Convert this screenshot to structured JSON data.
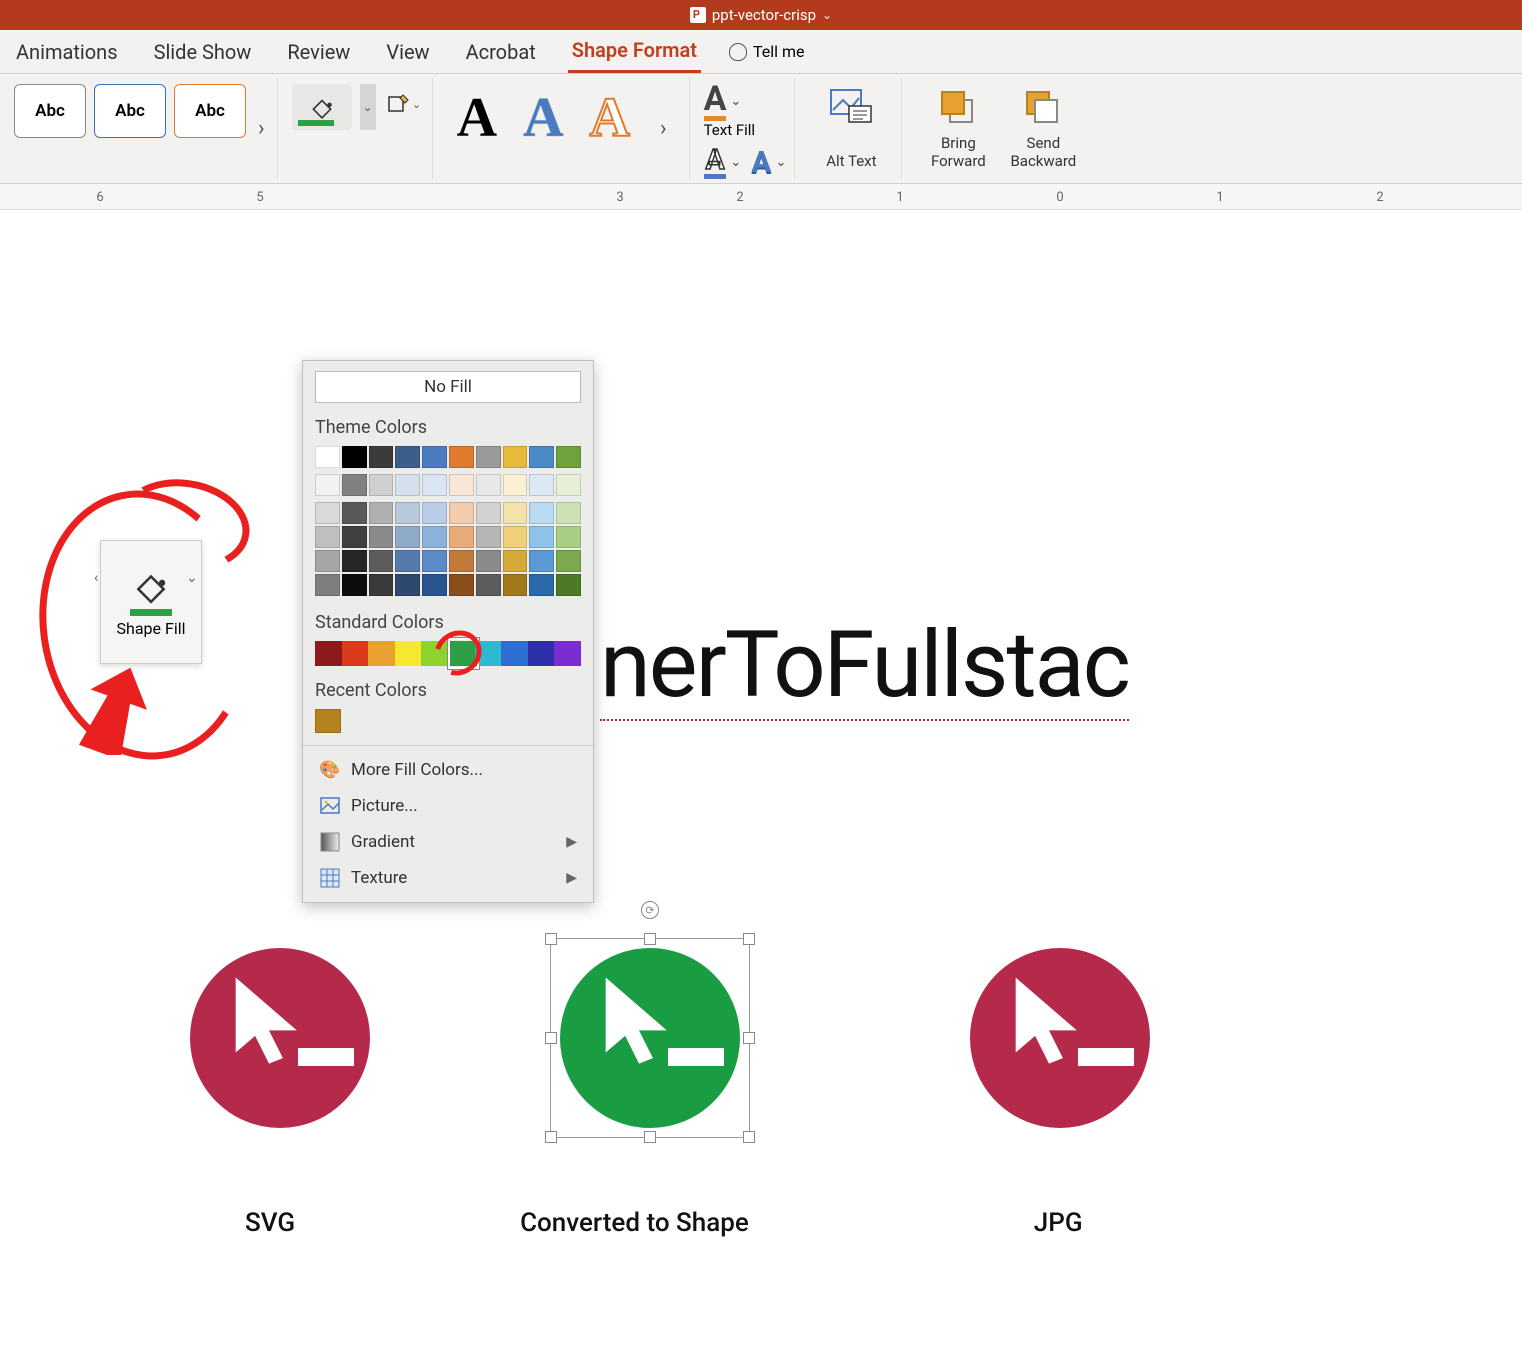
{
  "titlebar": {
    "filename": "ppt-vector-crisp"
  },
  "tabs": {
    "items": [
      "Animations",
      "Slide Show",
      "Review",
      "View",
      "Acrobat",
      "Shape Format"
    ],
    "active": "Shape Format",
    "tell_me": "Tell me"
  },
  "ribbon": {
    "style_label": "Abc",
    "text_fill": "Text Fill",
    "alt_text": "Alt Text",
    "bring_forward": "Bring Forward",
    "send_backward": "Send Backward"
  },
  "ruler": {
    "marks": [
      "6",
      "5",
      "3",
      "2",
      "1",
      "0",
      "1",
      "2"
    ]
  },
  "callout": {
    "label": "Shape Fill"
  },
  "dropdown": {
    "no_fill": "No Fill",
    "theme_heading": "Theme Colors",
    "standard_heading": "Standard Colors",
    "recent_heading": "Recent Colors",
    "more_colors": "More Fill Colors...",
    "picture": "Picture...",
    "gradient": "Gradient",
    "texture": "Texture",
    "theme_row1": [
      "#ffffff",
      "#000000",
      "#3b3b3b",
      "#3b5f8a",
      "#4a7abf",
      "#e07b2e",
      "#9a9a9a",
      "#e8b93a",
      "#4a8ac6",
      "#6fa23a"
    ],
    "theme_shades": [
      [
        "#f2f2f2",
        "#808080",
        "#d0d0d0",
        "#d6e0ec",
        "#dbe5f1",
        "#f8e6d6",
        "#e8e8e8",
        "#faf0d4",
        "#dce8f4",
        "#e6f0d8"
      ],
      [
        "#d9d9d9",
        "#595959",
        "#b0b0b0",
        "#b8c8dc",
        "#b9cde8",
        "#f1cdae",
        "#d2d2d2",
        "#f5e2aa",
        "#badaf0",
        "#cde2b4"
      ],
      [
        "#bfbfbf",
        "#404040",
        "#8a8a8a",
        "#8fa9c8",
        "#8db2da",
        "#e8ac7a",
        "#b6b6b6",
        "#efcf78",
        "#8fc2e6",
        "#a8cd84"
      ],
      [
        "#a6a6a6",
        "#262626",
        "#5c5c5c",
        "#557aac",
        "#5a8bc8",
        "#c27a3a",
        "#8a8a8a",
        "#d4a93a",
        "#5a9ad4",
        "#7aa94e"
      ],
      [
        "#7f7f7f",
        "#0d0d0d",
        "#3a3a3a",
        "#2e486e",
        "#2a5490",
        "#8a4e1c",
        "#5c5c5c",
        "#a07a1a",
        "#2a6aa8",
        "#4e7a28"
      ]
    ],
    "standard": [
      "#8c1a1a",
      "#d83a1a",
      "#e8a02e",
      "#f5e82e",
      "#8ed22e",
      "#2e9f46",
      "#2eb8d2",
      "#2e6ed2",
      "#2e2ea8",
      "#7a2ed2"
    ],
    "selected_standard_index": 5,
    "recent": [
      "#b5831e"
    ]
  },
  "slide": {
    "headline": "nerToFullstac",
    "labels": [
      "SVG",
      "Converted to Shape",
      "JPG"
    ],
    "colors": {
      "crimson": "#b52a4a",
      "green": "#1a9c42"
    }
  }
}
